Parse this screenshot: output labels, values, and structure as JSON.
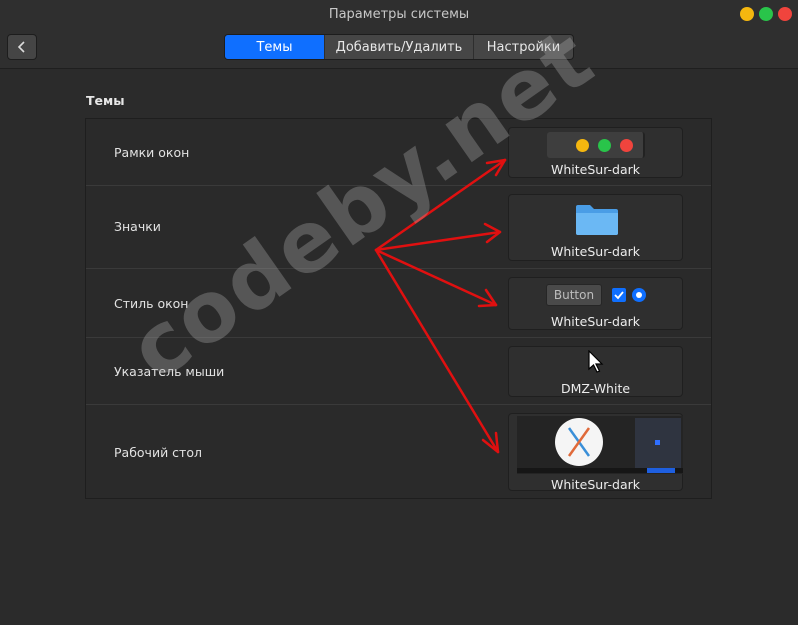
{
  "window": {
    "title": "Параметры системы"
  },
  "toolbar": {
    "tabs": [
      {
        "label": "Темы"
      },
      {
        "label": "Добавить/Удалить"
      },
      {
        "label": "Настройки"
      }
    ]
  },
  "section": {
    "title": "Темы"
  },
  "rows": [
    {
      "label": "Рамки окон",
      "value": "WhiteSur-dark"
    },
    {
      "label": "Значки",
      "value": "WhiteSur-dark"
    },
    {
      "label": "Стиль окон",
      "value": "WhiteSur-dark",
      "button_label": "Button"
    },
    {
      "label": "Указатель мыши",
      "value": "DMZ-White"
    },
    {
      "label": "Рабочий стол",
      "value": "WhiteSur-dark"
    }
  ],
  "watermark": "codeby.net",
  "colors": {
    "accent": "#0f6fff",
    "minimize": "#f5b70f",
    "maximize": "#29c44a",
    "close": "#f0443d",
    "annotation_arrow": "#e01010"
  }
}
